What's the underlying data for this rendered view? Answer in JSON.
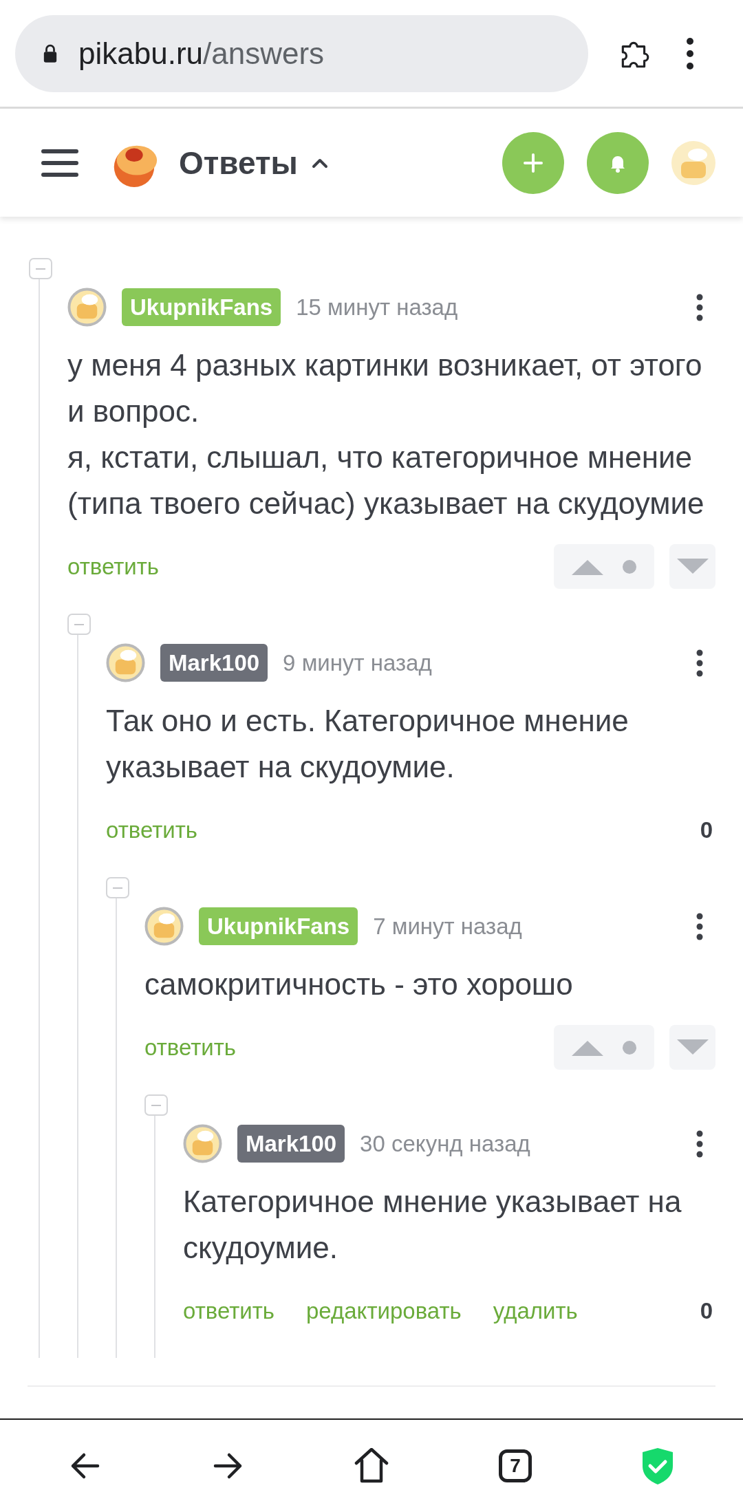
{
  "browser": {
    "url_host": "pikabu.ru",
    "url_path": "/answers"
  },
  "header": {
    "title": "Ответы",
    "expanded": true
  },
  "comments": [
    {
      "author": "UkupnikFans",
      "color": "#8ac858",
      "time": "15 минут назад",
      "text": "у меня 4 разных картинки возникает, от этого и вопрос.\nя, кстати, слышал, что категоричное мнение (типа твоего сейчас) указывает на скудоумие",
      "actions": [
        "ответить"
      ],
      "voting": true,
      "children": [
        {
          "author": "Mark100",
          "color": "#6c6f78",
          "time": "9 минут назад",
          "text": "Так оно и есть. Категоричное мнение указывает на скудоумие.",
          "actions": [
            "ответить"
          ],
          "voting": false,
          "rating": "0",
          "children": [
            {
              "author": "UkupnikFans",
              "color": "#8ac858",
              "time": "7 минут назад",
              "text": "самокритичность - это хорошо",
              "actions": [
                "ответить"
              ],
              "voting": true,
              "children": [
                {
                  "author": "Mark100",
                  "color": "#6c6f78",
                  "time": "30 секунд назад",
                  "text": "Категоричное мнение указывает на скудоумие.",
                  "actions": [
                    "ответить",
                    "редактировать",
                    "удалить"
                  ],
                  "voting": false,
                  "rating": "0"
                }
              ]
            }
          ]
        }
      ]
    }
  ],
  "bottom_nav": {
    "tab_count": "7"
  }
}
